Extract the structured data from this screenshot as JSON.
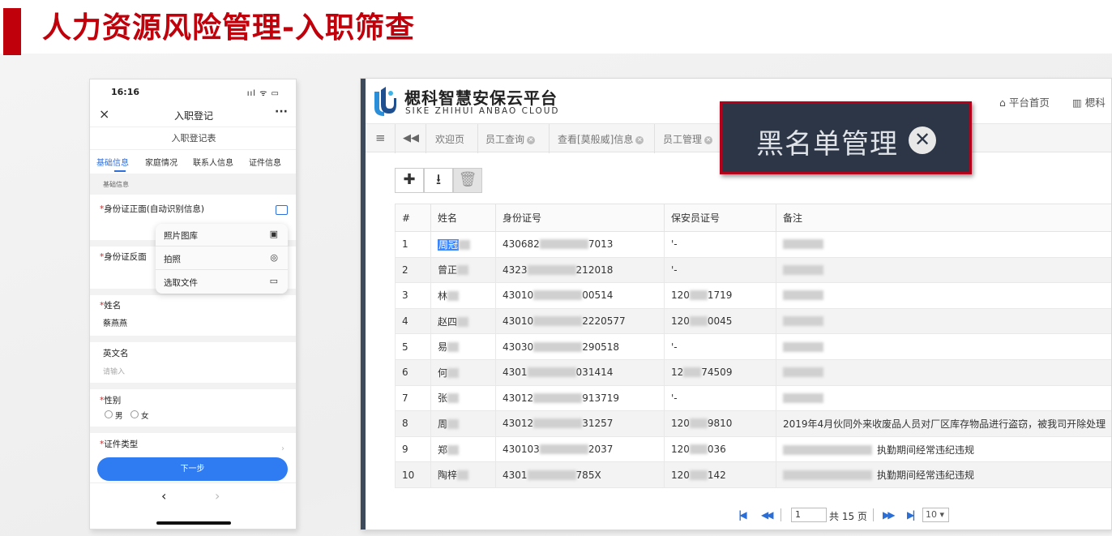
{
  "slide": {
    "title": "人力资源风险管理-入职筛查"
  },
  "phone": {
    "status_time": "16:16",
    "status_icons": "ııl ᯤ ▭",
    "nav_close": "×",
    "nav_title": "入职登记",
    "nav_more": "···",
    "form_title": "入职登记表",
    "tabs": [
      "基础信息",
      "家庭情况",
      "联系人信息",
      "证件信息"
    ],
    "section": "基础信息",
    "fields": {
      "id_front": "身份证正面(自动识别信息)",
      "id_back": "身份证反面",
      "name_label": "姓名",
      "name_value": "蔡燕燕",
      "eng_label": "英文名",
      "eng_placeholder": "请输入",
      "gender_label": "性别",
      "gender_male": "男",
      "gender_female": "女",
      "cert_label": "证件类型"
    },
    "popup": [
      "照片图库",
      "拍照",
      "选取文件"
    ],
    "next_button": "下一步",
    "nav_back": "‹",
    "nav_forward": "›"
  },
  "web": {
    "logo_cn": "楒科智慧安保云平台",
    "logo_en": "SIKE ZHIHUI ANBAO CLOUD",
    "header_links": [
      "平台首页",
      "楒科"
    ],
    "tabs": [
      "欢迎页",
      "员工查询",
      "查看[莫般威]信息",
      "员工管理"
    ],
    "columns": [
      "#",
      "姓名",
      "身份证号",
      "保安员证号",
      "备注"
    ],
    "rows": [
      {
        "no": "1",
        "name": "周冠",
        "id_pre": "430682",
        "id_suf": "7013",
        "cert_pre": "'-",
        "cert_suf": "",
        "note": ""
      },
      {
        "no": "2",
        "name": "曾正",
        "id_pre": "4323",
        "id_suf": "212018",
        "cert_pre": "'-",
        "cert_suf": "",
        "note": ""
      },
      {
        "no": "3",
        "name": "林",
        "id_pre": "43010",
        "id_suf": "00514",
        "cert_pre": "120",
        "cert_suf": "1719",
        "note": ""
      },
      {
        "no": "4",
        "name": "赵四",
        "id_pre": "43010",
        "id_suf": "2220577",
        "cert_pre": "120",
        "cert_suf": "0045",
        "note": ""
      },
      {
        "no": "5",
        "name": "易",
        "id_pre": "43030",
        "id_suf": "290518",
        "cert_pre": "'-",
        "cert_suf": "",
        "note": ""
      },
      {
        "no": "6",
        "name": "何",
        "id_pre": "4301",
        "id_suf": "031414",
        "cert_pre": "12",
        "cert_suf": "74509",
        "note": ""
      },
      {
        "no": "7",
        "name": "张",
        "id_pre": "43012",
        "id_suf": "913719",
        "cert_pre": "'-",
        "cert_suf": "",
        "note": ""
      },
      {
        "no": "8",
        "name": "周",
        "id_pre": "43012",
        "id_suf": "31257",
        "cert_pre": "120",
        "cert_suf": "9810",
        "note": "2019年4月伙同外来收废品人员对厂区库存物品进行盗窃，被我司开除处理"
      },
      {
        "no": "9",
        "name": "郑",
        "id_pre": "430103",
        "id_suf": "2037",
        "cert_pre": "120",
        "cert_suf": "036",
        "note": "执勤期间经常违纪违规"
      },
      {
        "no": "10",
        "name": "陶梓",
        "id_pre": "4301",
        "id_suf": "785X",
        "cert_pre": "120",
        "cert_suf": "142",
        "note": "执勤期间经常违纪违规"
      }
    ],
    "pager": {
      "page": "1",
      "total": "共 15 页",
      "size": "10"
    }
  },
  "callout": {
    "text": "黑名单管理",
    "icon": "close-circle-icon"
  },
  "colors": {
    "brand_red": "#c0000b",
    "accent_blue": "#2f7bf2",
    "callout_bg": "#2c3646"
  }
}
